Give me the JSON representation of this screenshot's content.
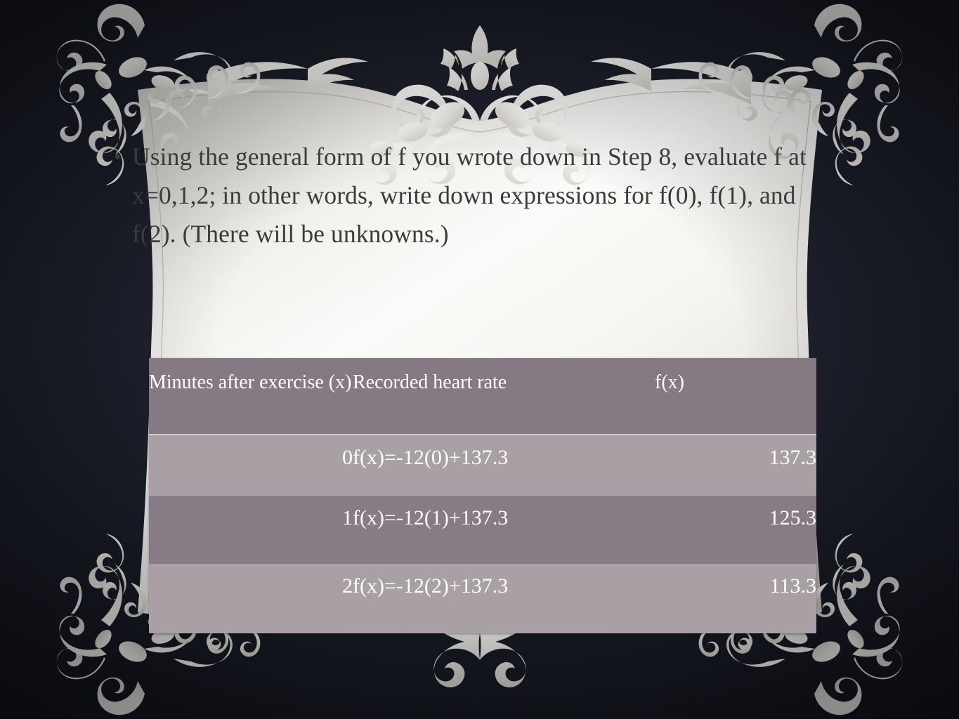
{
  "slide": {
    "background_color": "#171a24",
    "panel_color": "#f5f5f3",
    "ornament_color": "#eceae6"
  },
  "body": {
    "bullet_glyph": "•",
    "paragraph": "Using the general form of f you wrote down in Step 8, evaluate f at x=0,1,2; in other words, write down expressions for f(0), f(1), and f(2). (There will be unknowns.)"
  },
  "table": {
    "headers": {
      "col_x": "Minutes after exercise (x)",
      "col_expr": "Recorded heart rate",
      "col_fx": "f(x)"
    },
    "header_bg": "#857a83",
    "row_light_bg": "#a9a0a6",
    "row_dark_bg": "#877c85",
    "rows": [
      {
        "x": "0",
        "expr": "f(x)=-12(0)+137.3",
        "fx": "137.3"
      },
      {
        "x": "1",
        "expr": "f(x)=-12(1)+137.3",
        "fx": "125.3"
      },
      {
        "x": "2",
        "expr": "f(x)=-12(2)+137.3",
        "fx": "113.3"
      }
    ]
  }
}
